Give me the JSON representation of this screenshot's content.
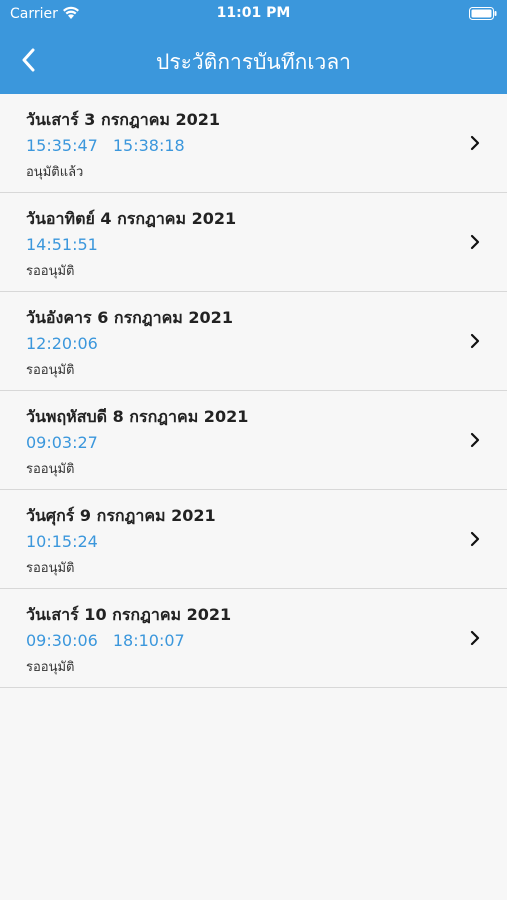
{
  "status_bar": {
    "carrier": "Carrier",
    "time": "11:01 PM"
  },
  "nav": {
    "title": "ประวัติการบันทึกเวลา",
    "back_icon": "chevron-left-icon"
  },
  "colors": {
    "header": "#3b97dc",
    "time_text": "#3b97dc",
    "background": "#f7f7f7"
  },
  "records": [
    {
      "date": "วันเสาร์ 3 กรกฎาคม 2021",
      "times": [
        "15:35:47",
        "15:38:18"
      ],
      "status": "อนุมัติแล้ว"
    },
    {
      "date": "วันอาทิตย์ 4 กรกฎาคม 2021",
      "times": [
        "14:51:51"
      ],
      "status": "รออนุมัติ"
    },
    {
      "date": "วันอังคาร 6 กรกฎาคม 2021",
      "times": [
        "12:20:06"
      ],
      "status": "รออนุมัติ"
    },
    {
      "date": "วันพฤหัสบดี 8 กรกฎาคม 2021",
      "times": [
        "09:03:27"
      ],
      "status": "รออนุมัติ"
    },
    {
      "date": "วันศุกร์ 9 กรกฎาคม 2021",
      "times": [
        "10:15:24"
      ],
      "status": "รออนุมัติ"
    },
    {
      "date": "วันเสาร์ 10 กรกฎาคม 2021",
      "times": [
        "09:30:06",
        "18:10:07"
      ],
      "status": "รออนุมัติ"
    }
  ]
}
